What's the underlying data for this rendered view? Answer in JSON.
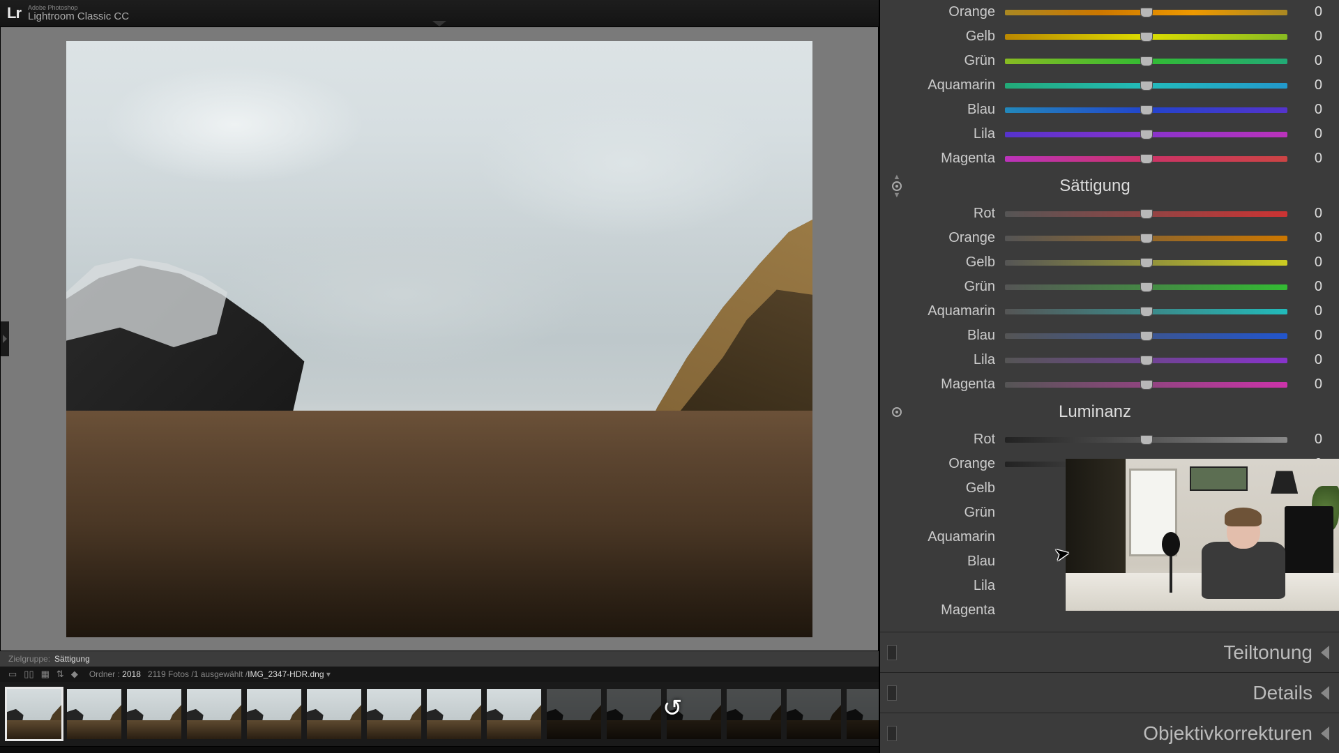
{
  "app": {
    "logo": "Lr",
    "brand_small": "Adobe Photoshop",
    "brand_main": "Lightroom Classic CC"
  },
  "status": {
    "label": "Zielgruppe:",
    "value": "Sättigung"
  },
  "info": {
    "folder_label": "Ordner :",
    "folder": "2018",
    "count": "2119 Fotos",
    "selected": "1 ausgewählt",
    "filename": "IMG_2347-HDR.dng"
  },
  "filmstrip": {
    "count": 15,
    "selected_index": 0,
    "dark_from": 9
  },
  "hue": {
    "items": [
      {
        "label": "Orange",
        "cls": "g-orange",
        "value": "0"
      },
      {
        "label": "Gelb",
        "cls": "g-gelb",
        "value": "0"
      },
      {
        "label": "Grün",
        "cls": "g-grun",
        "value": "0"
      },
      {
        "label": "Aquamarin",
        "cls": "g-aqua",
        "value": "0"
      },
      {
        "label": "Blau",
        "cls": "g-blau",
        "value": "0"
      },
      {
        "label": "Lila",
        "cls": "g-lila",
        "value": "0"
      },
      {
        "label": "Magenta",
        "cls": "g-mag",
        "value": "0"
      }
    ]
  },
  "saturation": {
    "title": "Sättigung",
    "items": [
      {
        "label": "Rot",
        "cls": "s-rot",
        "value": "0"
      },
      {
        "label": "Orange",
        "cls": "s-orange",
        "value": "0"
      },
      {
        "label": "Gelb",
        "cls": "s-gelb",
        "value": "0"
      },
      {
        "label": "Grün",
        "cls": "s-grun",
        "value": "0"
      },
      {
        "label": "Aquamarin",
        "cls": "s-aqua",
        "value": "0"
      },
      {
        "label": "Blau",
        "cls": "s-blau",
        "value": "0"
      },
      {
        "label": "Lila",
        "cls": "s-lila",
        "value": "0"
      },
      {
        "label": "Magenta",
        "cls": "s-mag",
        "value": "0"
      }
    ]
  },
  "luminance": {
    "title": "Luminanz",
    "items": [
      {
        "label": "Rot",
        "cls": "l-track",
        "g": "s-rot",
        "value": "0"
      },
      {
        "label": "Orange",
        "cls": "l-track",
        "g": "s-orange",
        "value": "0"
      },
      {
        "label": "Gelb",
        "cls": "l-track",
        "value": ""
      },
      {
        "label": "Grün",
        "cls": "l-track",
        "value": ""
      },
      {
        "label": "Aquamarin",
        "cls": "l-track",
        "value": ""
      },
      {
        "label": "Blau",
        "cls": "l-track",
        "value": ""
      },
      {
        "label": "Lila",
        "cls": "l-track",
        "value": ""
      },
      {
        "label": "Magenta",
        "cls": "l-track",
        "value": ""
      }
    ]
  },
  "collapsed": [
    {
      "title": "Teiltonung"
    },
    {
      "title": "Details"
    },
    {
      "title": "Objektivkorrekturen"
    }
  ]
}
